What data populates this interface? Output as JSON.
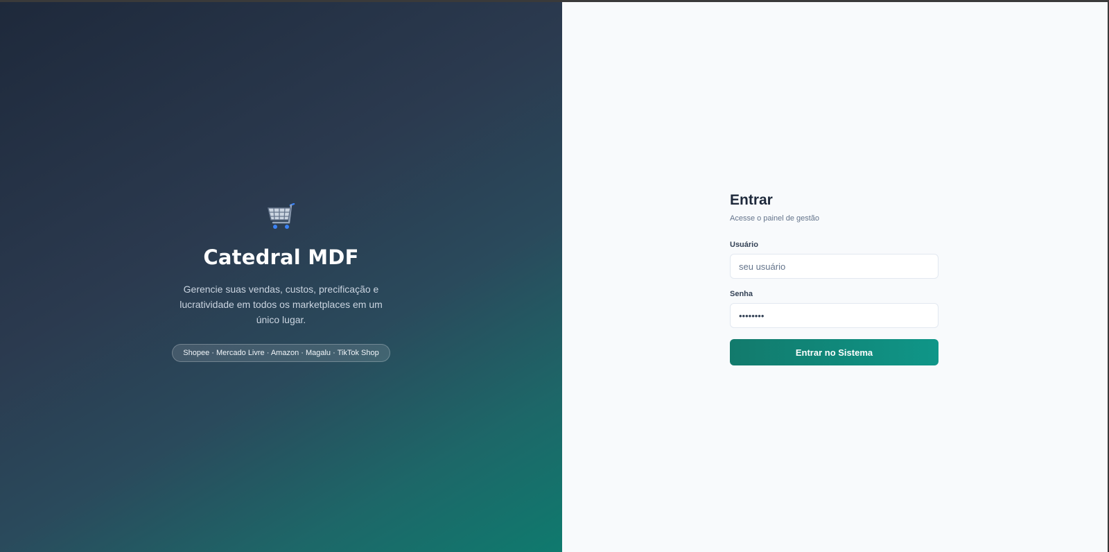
{
  "hero": {
    "icon": "shopping-cart-icon",
    "title": "Catedral MDF",
    "description": "Gerencie suas vendas, custos, precificação e lucratividade em todos os marketplaces em um único lugar.",
    "marketplaces": "Shopee · Mercado Livre · Amazon · Magalu · TikTok Shop"
  },
  "login": {
    "title": "Entrar",
    "subtitle": "Acesse o painel de gestão",
    "username_label": "Usuário",
    "username_placeholder": "seu usuário",
    "username_value": "",
    "password_label": "Senha",
    "password_value": "••••••••",
    "submit_label": "Entrar no Sistema"
  },
  "colors": {
    "accent": "#0f9688",
    "hero_dark": "#1e293b",
    "panel_bg": "#f8fafc"
  }
}
